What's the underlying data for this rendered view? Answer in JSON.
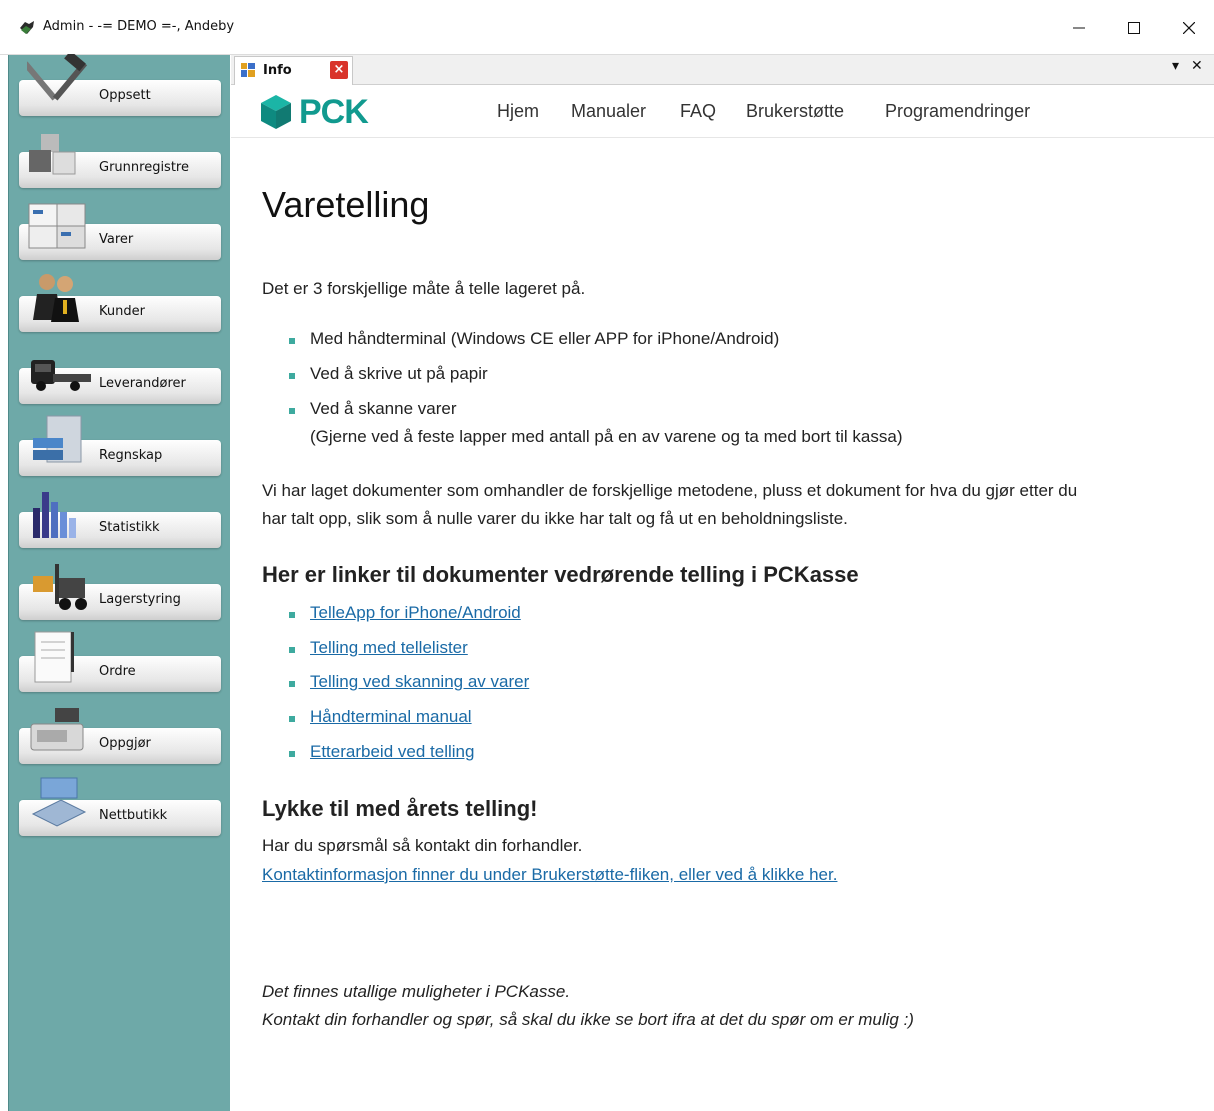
{
  "window": {
    "title": "Admin - -= DEMO =-, Andeby"
  },
  "sidebar": {
    "items": [
      {
        "label": "Oppsett",
        "icon": "tools-icon"
      },
      {
        "label": "Grunnregistre",
        "icon": "boxes-icon"
      },
      {
        "label": "Varer",
        "icon": "products-icon"
      },
      {
        "label": "Kunder",
        "icon": "customers-icon"
      },
      {
        "label": "Leverandører",
        "icon": "truck-icon"
      },
      {
        "label": "Regnskap",
        "icon": "cabinet-icon"
      },
      {
        "label": "Statistikk",
        "icon": "chart-icon"
      },
      {
        "label": "Lagerstyring",
        "icon": "forklift-icon"
      },
      {
        "label": "Ordre",
        "icon": "document-icon"
      },
      {
        "label": "Oppgjør",
        "icon": "register-icon"
      },
      {
        "label": "Nettbutikk",
        "icon": "webshop-icon"
      }
    ]
  },
  "tabs": [
    {
      "label": "Info",
      "active": true
    }
  ],
  "site": {
    "logo": "PCK",
    "nav": [
      "Hjem",
      "Manualer",
      "FAQ",
      "Brukerstøtte",
      "Programendringer"
    ]
  },
  "page": {
    "title": "Varetelling",
    "intro": "Det er 3 forskjellige måte å telle lageret på.",
    "methods": [
      "Med håndterminal (Windows CE eller APP for iPhone/Android)",
      "Ved å skrive ut på papir",
      "Ved å skanne varer"
    ],
    "methods_note": "(Gjerne ved å feste lapper med antall på en av varene og ta med bort til kassa)",
    "para_line1": "Vi har laget dokumenter som omhandler de forskjellige metodene, pluss et dokument for hva du gjør etter du",
    "para_line2": "har talt opp, slik som å nulle varer du ikke har talt og få ut en beholdningsliste.",
    "links_heading": "Her er linker til dokumenter vedrørende telling i PCKasse",
    "links": [
      "TelleApp for iPhone/Android",
      "Telling med tellelister",
      "Telling ved skanning av varer",
      "Håndterminal manual",
      "Etterarbeid ved telling"
    ],
    "closing_heading": "Lykke til med årets telling!",
    "closing_text": "Har du spørsmål så kontakt din forhandler.",
    "contact_link": "Kontaktinformasjon finner du under Brukerstøtte-fliken, eller ved å klikke her.",
    "footer_line1": "Det finnes utallige muligheter i PCKasse.",
    "footer_line2": "Kontakt din forhandler og spør, så skal du ikke se bort ifra at det du spør om er mulig :)"
  },
  "colors": {
    "sidebar": "#6ea9a8",
    "brand": "#119a8f",
    "link": "#1a6aa6",
    "bullet": "#3eaa9f"
  }
}
